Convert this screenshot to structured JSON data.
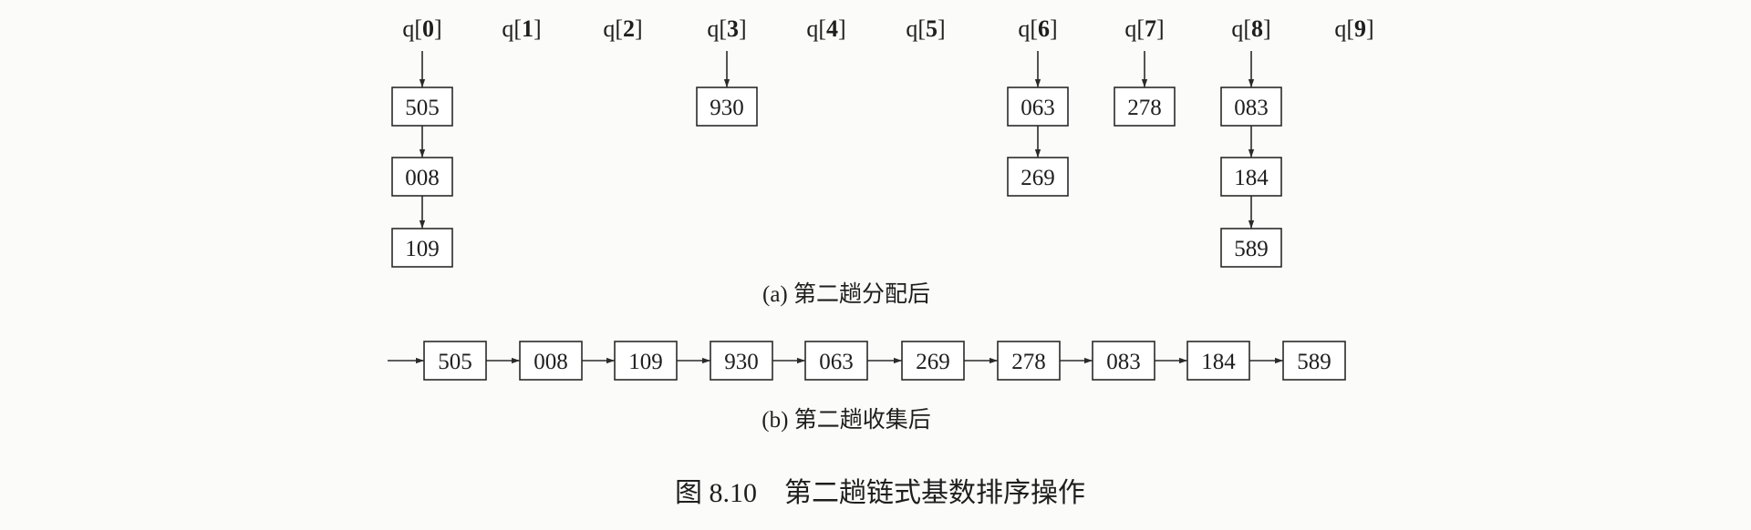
{
  "part_a": {
    "buckets": [
      {
        "label": "q[",
        "index": "0",
        "close": "]",
        "items": [
          "505",
          "008",
          "109"
        ]
      },
      {
        "label": "q[",
        "index": "1",
        "close": "]",
        "items": []
      },
      {
        "label": "q[",
        "index": "2",
        "close": "]",
        "items": []
      },
      {
        "label": "q[",
        "index": "3",
        "close": "]",
        "items": [
          "930"
        ]
      },
      {
        "label": "q[",
        "index": "4",
        "close": "]",
        "items": []
      },
      {
        "label": "q[",
        "index": "5",
        "close": "]",
        "items": []
      },
      {
        "label": "q[",
        "index": "6",
        "close": "]",
        "items": [
          "063",
          "269"
        ]
      },
      {
        "label": "q[",
        "index": "7",
        "close": "]",
        "items": [
          "278"
        ]
      },
      {
        "label": "q[",
        "index": "8",
        "close": "]",
        "items": [
          "083",
          "184",
          "589"
        ]
      },
      {
        "label": "q[",
        "index": "9",
        "close": "]",
        "items": []
      }
    ],
    "caption": "(a) 第二趟分配后"
  },
  "part_b": {
    "list": [
      "505",
      "008",
      "109",
      "930",
      "063",
      "269",
      "278",
      "083",
      "184",
      "589"
    ],
    "caption": "(b) 第二趟收集后"
  },
  "figure_caption": "图 8.10　第二趟链式基数排序操作"
}
